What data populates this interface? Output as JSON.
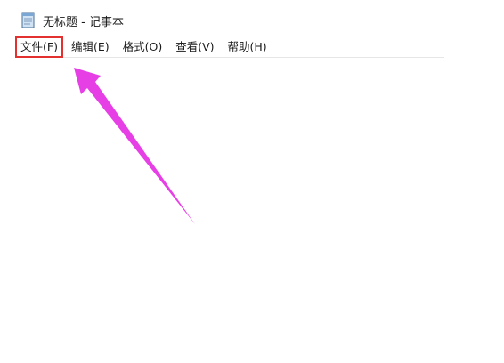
{
  "window": {
    "title": "无标题 - 记事本"
  },
  "menubar": {
    "items": [
      {
        "label": "文件(F)"
      },
      {
        "label": "编辑(E)"
      },
      {
        "label": "格式(O)"
      },
      {
        "label": "查看(V)"
      },
      {
        "label": "帮助(H)"
      }
    ]
  },
  "editor": {
    "content": ""
  },
  "icons": {
    "app": "notepad-icon",
    "annotation": "arrow-pointer"
  },
  "colors": {
    "highlight_box": "#e2312e",
    "annotation_arrow": "#e73fe6"
  }
}
